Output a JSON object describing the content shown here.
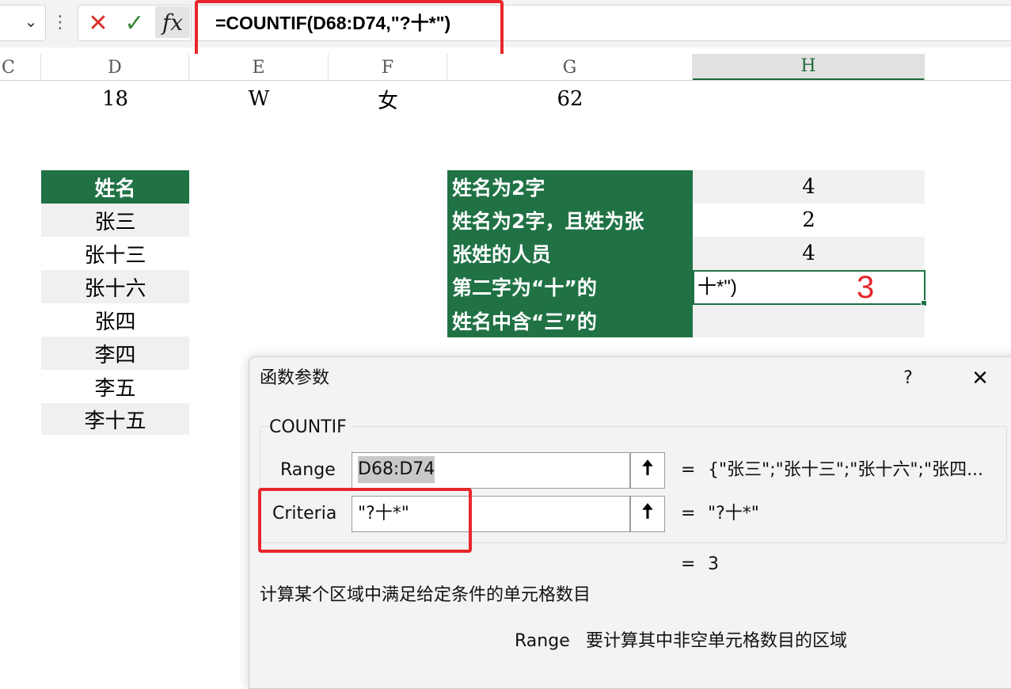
{
  "formula_bar": {
    "name_box_arrow": "chevron-down-icon",
    "cancel_glyph": "✕",
    "enter_glyph": "✓",
    "fx_label": "fx",
    "formula": "=COUNTIF(D68:D74,\"?十*\")"
  },
  "columns": [
    "C",
    "D",
    "E",
    "F",
    "G",
    "H"
  ],
  "row1": {
    "d": "18",
    "e": "W",
    "f": "女",
    "g": "62"
  },
  "names": {
    "header": "姓名",
    "items": [
      "张三",
      "张十三",
      "张十六",
      "张四",
      "李四",
      "李五",
      "李十五"
    ]
  },
  "summary": {
    "labels": [
      "姓名为2字",
      "姓名为2字，且姓为张",
      "张姓的人员",
      "第二字为“十”的",
      "姓名中含“三”的"
    ],
    "values": [
      "4",
      "2",
      "4",
      "",
      ""
    ],
    "edit_text": "十*\")",
    "annotation": "3"
  },
  "dialog": {
    "title": "函数参数",
    "help": "?",
    "close": "✕",
    "function_name": "COUNTIF",
    "range_label": "Range",
    "range_value": "D68:D74",
    "range_result": "{\"张三\";\"张十三\";\"张十六\";\"张四...",
    "criteria_label": "Criteria",
    "criteria_value": "\"?十*\"",
    "criteria_result": "\"?十*\"",
    "eq": "=",
    "formula_result": "3",
    "description": "计算某个区域中满足给定条件的单元格数目",
    "arg_name": "Range",
    "arg_desc": "要计算其中非空单元格数目的区域",
    "collapse_glyph": "🠅"
  },
  "colors": {
    "header_green": "#207245",
    "highlight_red": "#e8262b"
  }
}
